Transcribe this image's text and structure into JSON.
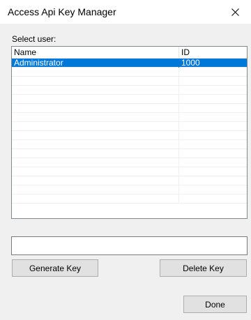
{
  "window": {
    "title": "Access Api Key Manager",
    "close_icon": "close-icon"
  },
  "user_select": {
    "label": "Select user:",
    "columns": [
      "Name",
      "ID"
    ],
    "rows": [
      {
        "name": "Administrator",
        "id": "1000",
        "selected": true
      }
    ],
    "selection_color": "#0078d7"
  },
  "key_field": {
    "value": "",
    "placeholder": ""
  },
  "buttons": {
    "generate": "Generate Key",
    "delete": "Delete Key",
    "done": "Done"
  }
}
